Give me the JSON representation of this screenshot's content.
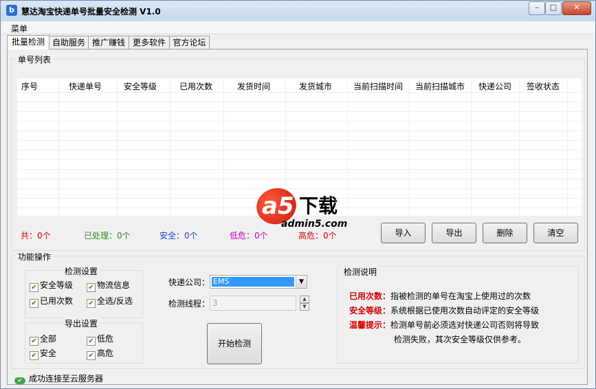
{
  "window": {
    "title": "慧达淘宝快递单号批量安全检测 V1.0",
    "app_icon": "b",
    "minimize": "–",
    "maximize": "□",
    "close": "✕"
  },
  "menu": {
    "label": "菜单"
  },
  "tabs": [
    "批量检测",
    "自助服务",
    "推广赚钱",
    "更多软件",
    "官方论坛"
  ],
  "list_section": {
    "title": "单号列表",
    "columns": [
      "序号",
      "快递单号",
      "安全等级",
      "已用次数",
      "发货时间",
      "发货城市",
      "当前扫描时间",
      "当前扫描城市",
      "快递公司",
      "签收状态"
    ],
    "rows": []
  },
  "watermark": {
    "logo": "a5",
    "text": "下载",
    "site": "admin5.com"
  },
  "stats": {
    "total": "共：0个",
    "processed": "已处理：0个",
    "safe": "安全：0个",
    "low_risk": "低危：0个",
    "high_risk": "高危：0个"
  },
  "actions": {
    "import": "导入",
    "export": "导出",
    "delete": "删除",
    "clear": "清空"
  },
  "function_section": {
    "title": "功能操作",
    "check_settings": {
      "title": "检测设置",
      "options": [
        {
          "label": "安全等级",
          "checked": true
        },
        {
          "label": "物流信息",
          "checked": true
        },
        {
          "label": "已用次数",
          "checked": true
        },
        {
          "label": "全选/反选",
          "checked": true
        }
      ]
    },
    "export_settings": {
      "title": "导出设置",
      "options": [
        {
          "label": "全部",
          "checked": true
        },
        {
          "label": "低危",
          "checked": true
        },
        {
          "label": "安全",
          "checked": true
        },
        {
          "label": "高危",
          "checked": true
        }
      ]
    },
    "courier_label": "快递公司：",
    "courier_value": "EMS",
    "threads_label": "检测线程：",
    "threads_value": "3",
    "start_button": "开始检测"
  },
  "help": {
    "title": "检测说明",
    "lines": [
      {
        "key": "已用次数：",
        "text": "指被检测的单号在淘宝上使用过的次数"
      },
      {
        "key": "安全等级：",
        "text": "系统根据已使用次数自动评定的安全等级"
      },
      {
        "key": "温馨提示：",
        "text": "检测单号前必须选对快递公司否则将导致"
      },
      {
        "key": "",
        "text": "检测失败，其次安全等级仅供参考。"
      }
    ]
  },
  "status": {
    "text": "成功连接至云服务器"
  },
  "colors": {
    "total": "#d40000",
    "processed": "#2e8b22",
    "safe": "#1f3fc8",
    "low_risk": "#c000c0",
    "high_risk": "#d40000",
    "help_key": "#d40000"
  }
}
